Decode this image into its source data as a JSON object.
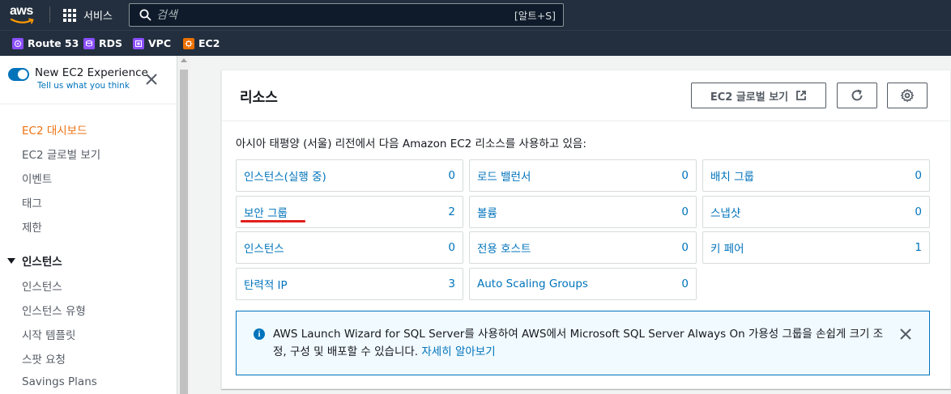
{
  "topbar": {
    "logo": "aws",
    "services_label": "서비스",
    "search_placeholder": "검색",
    "search_shortcut": "[알트+S]"
  },
  "favorites": [
    {
      "label": "Route 53",
      "icon": "route53-icon",
      "color": "#8c4fff"
    },
    {
      "label": "RDS",
      "icon": "rds-icon",
      "color": "#8c4fff"
    },
    {
      "label": "VPC",
      "icon": "vpc-icon",
      "color": "#8c4fff"
    },
    {
      "label": "EC2",
      "icon": "ec2-icon",
      "color": "#ed7100"
    }
  ],
  "sidebar": {
    "toggle_title": "New EC2 Experience",
    "toggle_link": "Tell us what you think",
    "items": [
      {
        "label": "EC2 대시보드",
        "active": true
      },
      {
        "label": "EC2 글로벌 보기"
      },
      {
        "label": "이벤트"
      },
      {
        "label": "태그"
      },
      {
        "label": "제한"
      }
    ],
    "section": "인스턴스",
    "section_items": [
      {
        "label": "인스턴스"
      },
      {
        "label": "인스턴스 유형"
      },
      {
        "label": "시작 템플릿"
      },
      {
        "label": "스팟 요청"
      },
      {
        "label": "Savings Plans"
      }
    ]
  },
  "resources": {
    "title": "리소스",
    "global_view_button": "EC2 글로벌 보기",
    "description": "아시아 태평양 (서울) 리전에서 다음 Amazon EC2 리소스를 사용하고 있음:",
    "cells": [
      {
        "label": "인스턴스(실행 중)",
        "count": "0"
      },
      {
        "label": "로드 밸런서",
        "count": "0"
      },
      {
        "label": "배치 그룹",
        "count": "0"
      },
      {
        "label": "보안 그룹",
        "count": "2"
      },
      {
        "label": "볼륨",
        "count": "0"
      },
      {
        "label": "스냅샷",
        "count": "0"
      },
      {
        "label": "인스턴스",
        "count": "0"
      },
      {
        "label": "전용 호스트",
        "count": "0"
      },
      {
        "label": "키 페어",
        "count": "1"
      },
      {
        "label": "탄력적 IP",
        "count": "3"
      },
      {
        "label": "Auto Scaling Groups",
        "count": "0"
      }
    ],
    "info_text": "AWS Launch Wizard for SQL Server를 사용하여 AWS에서 Microsoft SQL Server Always On 가용성 그룹을 손쉽게 크기 조정, 구성 및 배포할 수 있습니다.",
    "info_link": "자세히 알아보기"
  },
  "colors": {
    "header_bg": "#232f3e",
    "link": "#0073bb",
    "active_nav": "#ec7211",
    "annotation_underline": "#e0201c"
  }
}
